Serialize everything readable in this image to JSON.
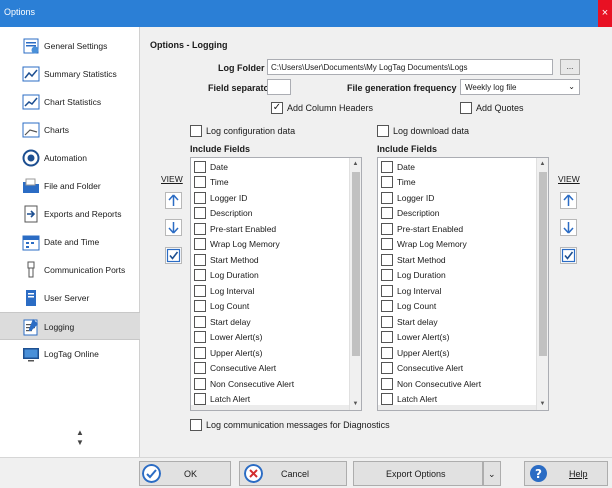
{
  "window": {
    "title": "Options",
    "close": "×"
  },
  "sidebar": {
    "items": [
      {
        "label": "General Settings",
        "icon": "settings-icon"
      },
      {
        "label": "Summary Statistics",
        "icon": "summary-chart-icon"
      },
      {
        "label": "Chart Statistics",
        "icon": "chart-stats-icon"
      },
      {
        "label": "Charts",
        "icon": "charts-icon"
      },
      {
        "label": "Automation",
        "icon": "automation-icon"
      },
      {
        "label": "File and Folder",
        "icon": "folder-icon"
      },
      {
        "label": "Exports and Reports",
        "icon": "export-icon"
      },
      {
        "label": "Date and Time",
        "icon": "calendar-icon"
      },
      {
        "label": "Communication Ports",
        "icon": "usb-icon"
      },
      {
        "label": "User Server",
        "icon": "server-icon"
      },
      {
        "label": "Logging",
        "icon": "logging-icon"
      },
      {
        "label": "LogTag Online",
        "icon": "online-icon"
      }
    ],
    "selected": "Logging",
    "scroll_up": "▲",
    "scroll_down": "▼"
  },
  "main": {
    "heading": "Options - Logging",
    "log_folder": {
      "label": "Log Folder",
      "value": "C:\\Users\\User\\Documents\\My LogTag Documents\\Logs",
      "browse": "..."
    },
    "field_separator": {
      "label": "Field separator",
      "value": ""
    },
    "file_generation": {
      "label": "File generation frequency",
      "value": "Weekly log file",
      "arrow": "⌄"
    },
    "add_column_headers": {
      "label": "Add Column Headers",
      "checked": true
    },
    "add_quotes": {
      "label": "Add Quotes",
      "checked": false
    },
    "log_configuration": {
      "label": "Log configuration data",
      "checked": false
    },
    "log_download": {
      "label": "Log download data",
      "checked": false
    },
    "left_list": {
      "header": "Include Fields",
      "fields": [
        "Date",
        "Time",
        "Logger ID",
        "Description",
        "Pre-start Enabled",
        "Wrap Log Memory",
        "Start Method",
        "Log Duration",
        "Log Interval",
        "Log Count",
        "Start delay",
        "Lower Alert(s)",
        "Upper Alert(s)",
        "Consecutive Alert",
        "Non Consecutive Alert",
        "Latch Alert"
      ]
    },
    "right_list": {
      "header": "Include Fields",
      "fields": [
        "Date",
        "Time",
        "Logger ID",
        "Description",
        "Pre-start Enabled",
        "Wrap Log Memory",
        "Start Method",
        "Log Duration",
        "Log Interval",
        "Log Count",
        "Start delay",
        "Lower Alert(s)",
        "Upper Alert(s)",
        "Consecutive Alert",
        "Non Consecutive Alert",
        "Latch Alert"
      ]
    },
    "view_label": "VIEW",
    "log_comm_messages": {
      "label": "Log communication messages for Diagnostics",
      "checked": false
    }
  },
  "footer": {
    "ok": "OK",
    "cancel": "Cancel",
    "export": "Export Options",
    "export_arrow": "⌄",
    "help": "Help",
    "help_glyph": "?"
  },
  "colors": {
    "titlebar": "#2b7fd6",
    "close": "#e81123",
    "accent_blue": "#2b6cc4",
    "cancel_red": "#d32f2f"
  }
}
